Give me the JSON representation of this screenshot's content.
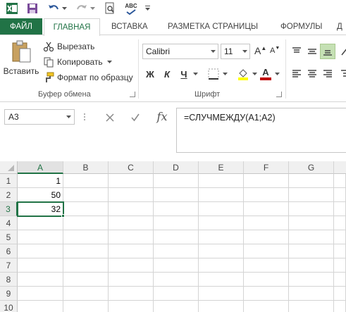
{
  "qat": {
    "icons": [
      "excel-app-icon",
      "save-icon",
      "undo-icon",
      "redo-icon",
      "print-preview-icon",
      "spelling-icon",
      "customize-qat-icon"
    ],
    "spelling_text": "ABC"
  },
  "tabs": [
    {
      "label": "ФАЙЛ"
    },
    {
      "label": "ГЛАВНАЯ"
    },
    {
      "label": "ВСТАВКА"
    },
    {
      "label": "РАЗМЕТКА СТРАНИЦЫ"
    },
    {
      "label": "ФОРМУЛЫ"
    },
    {
      "label": "Д"
    }
  ],
  "clipboard": {
    "paste_label": "Вставить",
    "cut_label": "Вырезать",
    "copy_label": "Копировать",
    "format_painter_label": "Формат по образцу",
    "group_label": "Буфер обмена"
  },
  "font": {
    "family": "Calibri",
    "size": "11",
    "grow_label": "A",
    "shrink_label": "A",
    "bold": "Ж",
    "italic": "К",
    "underline": "Ч",
    "font_color_letter": "A",
    "fill_color": "#FFFF00",
    "text_color": "#C00000",
    "group_label": "Шрифт"
  },
  "formula_bar": {
    "name_box": "A3",
    "cancel_icon": "close-icon",
    "enter_icon": "check-icon",
    "fx_label": "fx",
    "formula": "=СЛУЧМЕЖДУ(A1;A2)"
  },
  "sheet": {
    "columns": [
      "A",
      "B",
      "C",
      "D",
      "E",
      "F",
      "G"
    ],
    "rows": [
      "1",
      "2",
      "3",
      "4",
      "5",
      "6",
      "7",
      "8",
      "9",
      "10"
    ],
    "cells": {
      "A1": "1",
      "A2": "50",
      "A3": "32"
    },
    "active_cell": "A3"
  },
  "colors": {
    "accent": "#217346",
    "file_tab": "#217346"
  }
}
